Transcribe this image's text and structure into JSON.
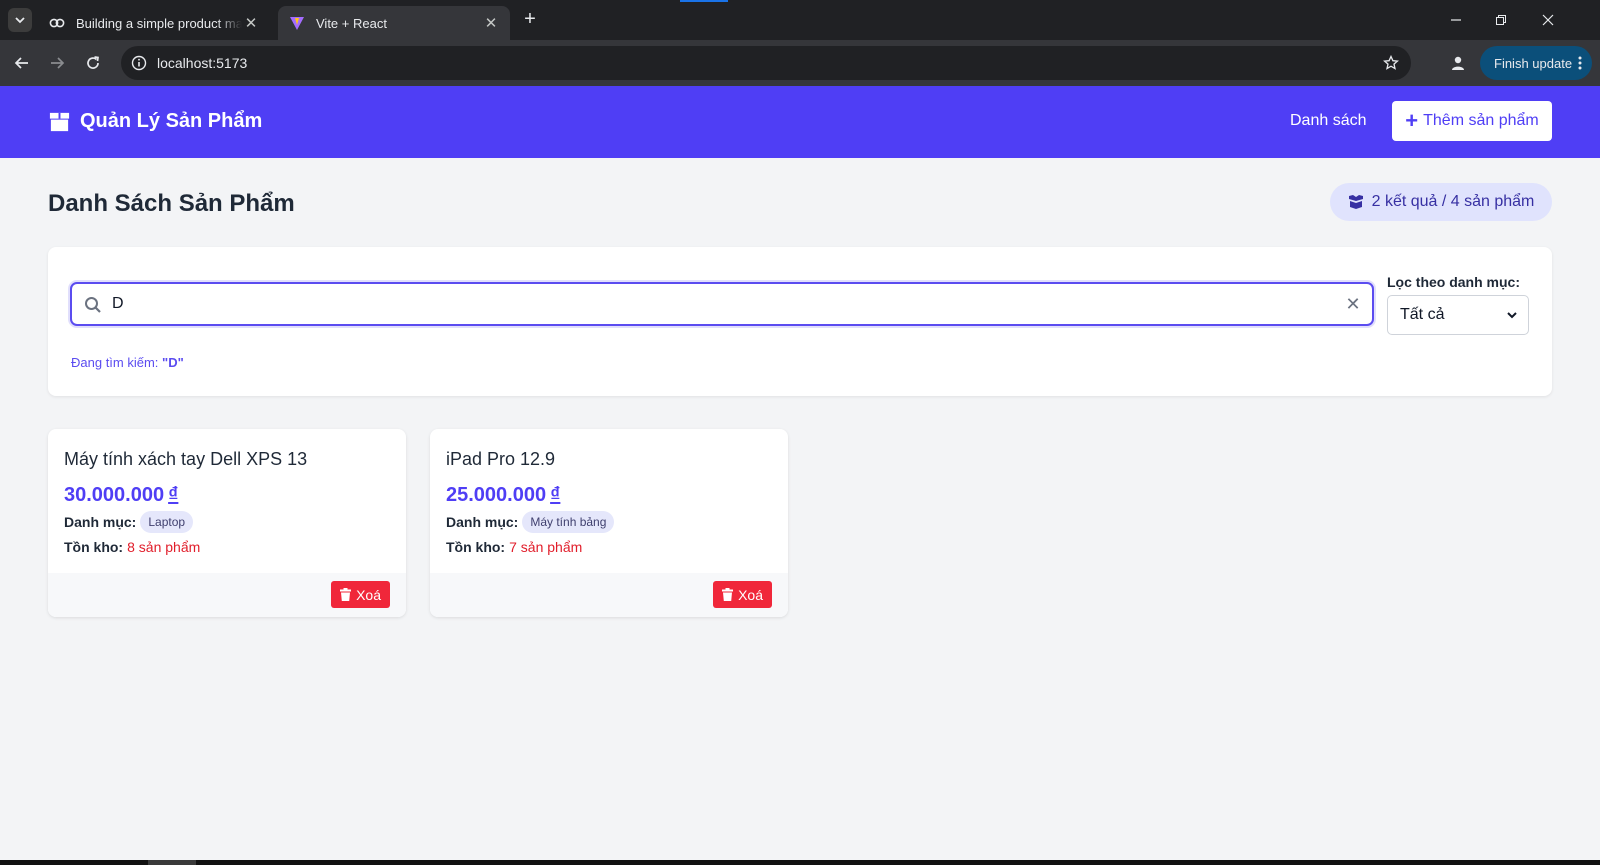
{
  "browser": {
    "tabs": [
      {
        "title": "Building a simple product mana",
        "active": false
      },
      {
        "title": "Vite + React",
        "active": true
      }
    ],
    "url": "localhost:5173",
    "update_label": "Finish update"
  },
  "header": {
    "brand": "Quản Lý Sản Phẩm",
    "nav_link": "Danh sách",
    "add_button": "Thêm sản phẩm",
    "accent_color": "#4f3ef5"
  },
  "page": {
    "title": "Danh Sách Sản Phẩm",
    "count": "2 kết quả / 4 sản phẩm"
  },
  "search": {
    "value": "D",
    "status_prefix": "Đang tìm kiếm:",
    "status_term": "\"D\"",
    "filter_label": "Lọc theo danh mục:",
    "filter_selected": "Tất cả"
  },
  "products": [
    {
      "name": "Máy tính xách tay Dell XPS 13",
      "price": "30.000.000",
      "currency": "₫",
      "category_label": "Danh mục:",
      "category": "Laptop",
      "stock_label": "Tồn kho:",
      "stock": "8 sản phẩm",
      "delete_label": "Xoá"
    },
    {
      "name": "iPad Pro 12.9",
      "price": "25.000.000",
      "currency": "₫",
      "category_label": "Danh mục:",
      "category": "Máy tính bảng",
      "stock_label": "Tồn kho:",
      "stock": "7 sản phẩm",
      "delete_label": "Xoá"
    }
  ]
}
